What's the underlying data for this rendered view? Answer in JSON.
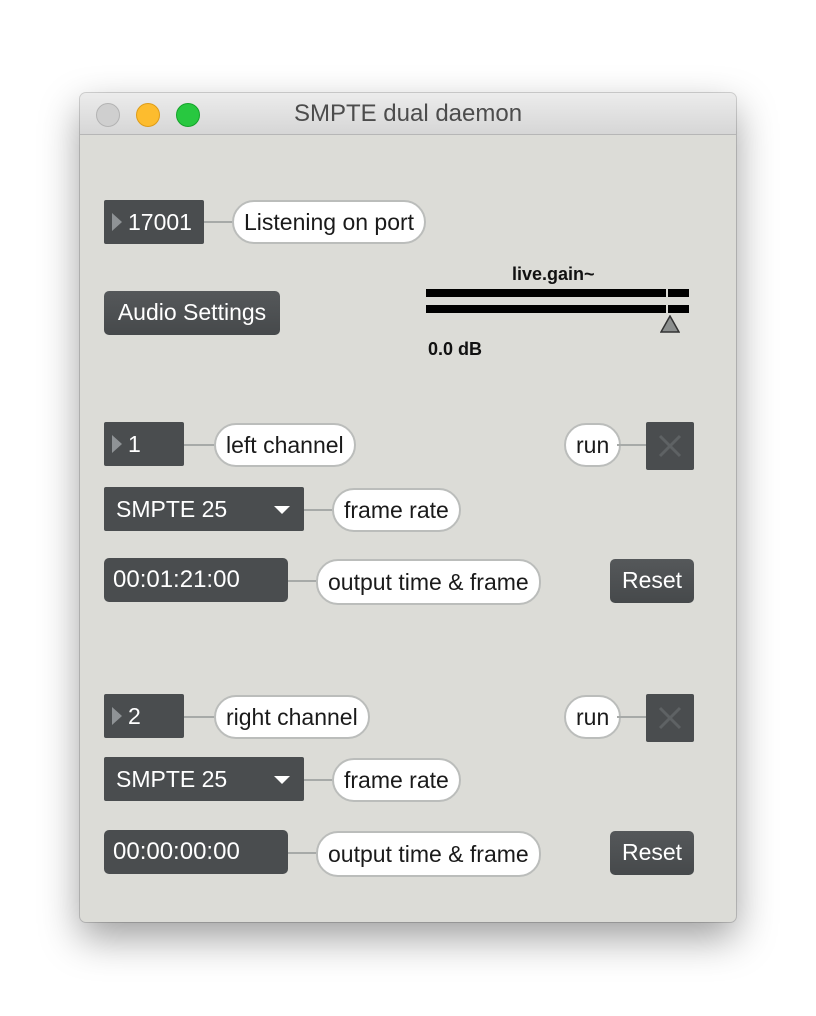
{
  "window": {
    "title": "SMPTE dual daemon"
  },
  "network": {
    "port_value": "17001",
    "port_comment": "Listening on port"
  },
  "audio": {
    "settings_label": "Audio Settings",
    "gain_label": "live.gain~",
    "gain_value": "0.0 dB"
  },
  "channels": [
    {
      "channel_value": "1",
      "channel_comment": "left channel",
      "run_label": "run",
      "framerate_value": "SMPTE 25",
      "framerate_comment": "frame rate",
      "time_value": "00:01:21:00",
      "time_comment": "output time & frame",
      "reset_label": "Reset"
    },
    {
      "channel_value": "2",
      "channel_comment": "right channel",
      "run_label": "run",
      "framerate_value": "SMPTE 25",
      "framerate_comment": "frame rate",
      "time_value": "00:00:00:00",
      "time_comment": "output time & frame",
      "reset_label": "Reset"
    }
  ],
  "icons": {
    "toggle": "x-icon",
    "gain_slider": "triangle-up-icon",
    "numbox": "triangle-right-icon",
    "menu": "chevron-down-icon"
  }
}
